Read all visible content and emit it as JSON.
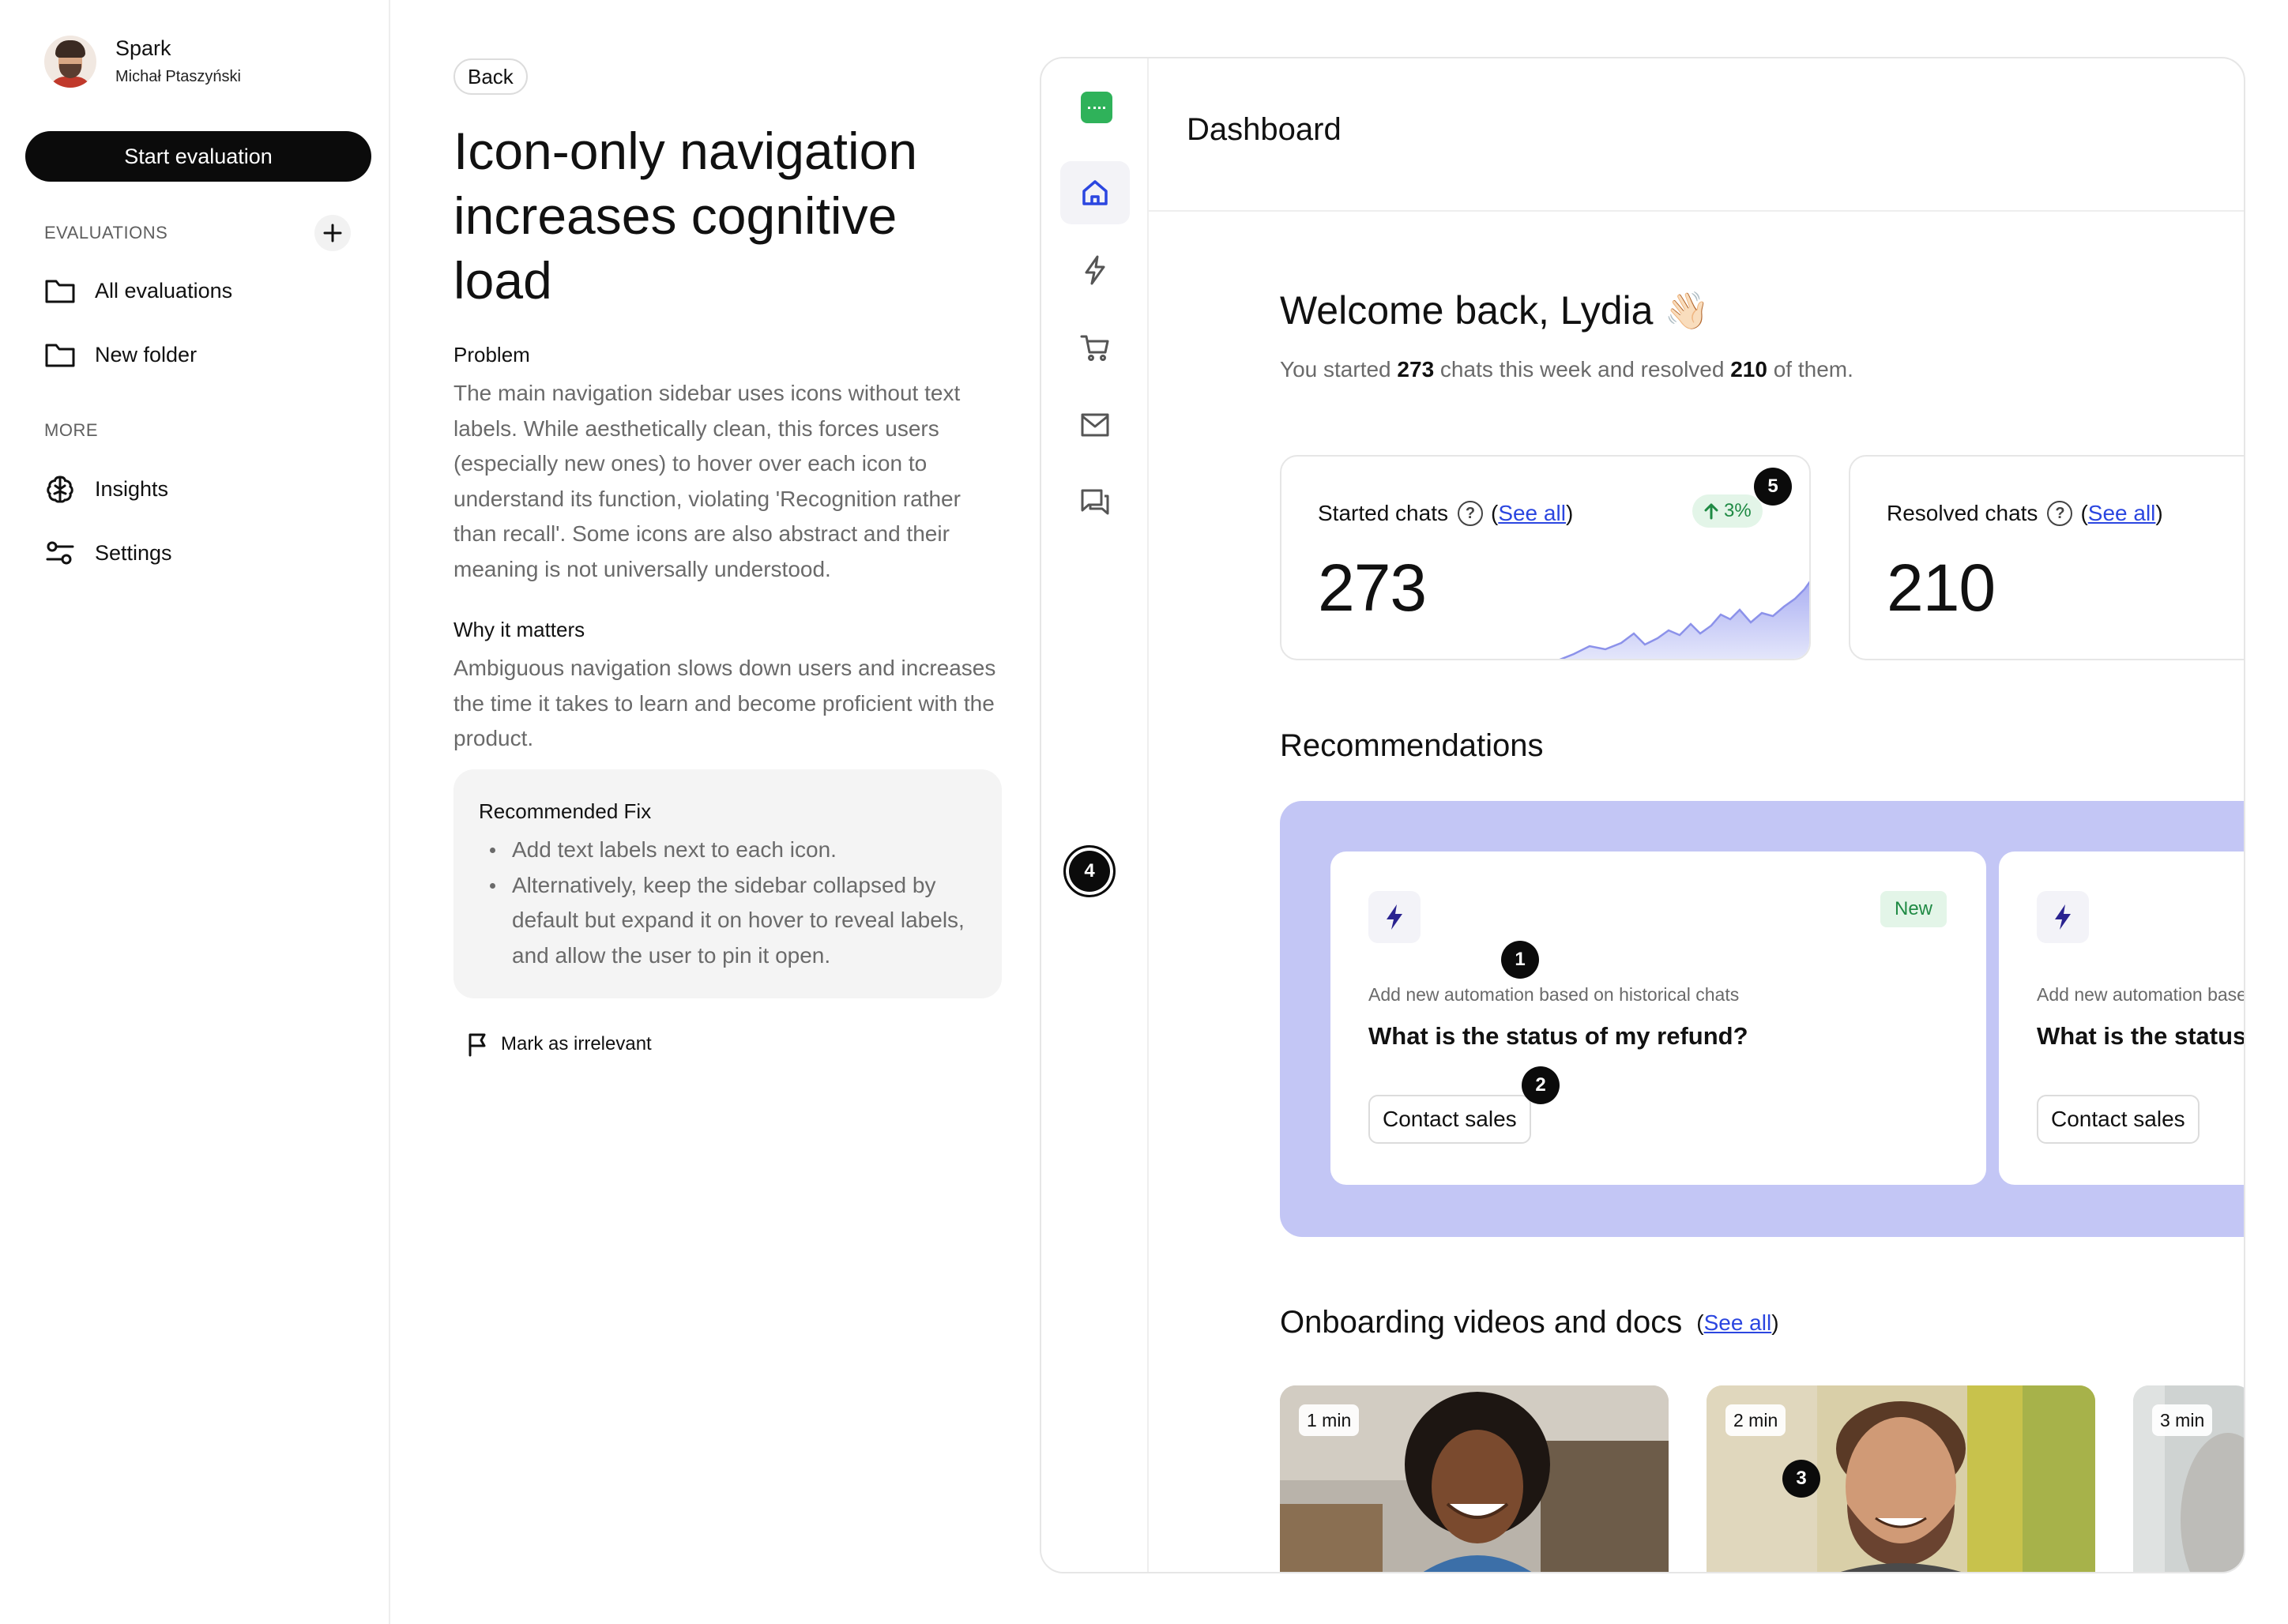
{
  "sidebar": {
    "profile": {
      "name": "Spark",
      "subtitle": "Michał Ptaszyński"
    },
    "start_button": "Start evaluation",
    "evaluations_label": "EVALUATIONS",
    "evaluations": [
      {
        "label": "All evaluations",
        "icon": "folder-icon"
      },
      {
        "label": "New folder",
        "icon": "folder-icon"
      }
    ],
    "more_label": "MORE",
    "more": [
      {
        "label": "Insights",
        "icon": "brain-icon"
      },
      {
        "label": "Settings",
        "icon": "sliders-icon"
      }
    ]
  },
  "issue": {
    "back": "Back",
    "title": "Icon-only navigation increases cognitive load",
    "problem_heading": "Problem",
    "problem_text": "The main navigation sidebar uses icons without text labels. While aesthetically clean, this forces users (especially new ones) to hover over each icon to understand its function, violating 'Recognition rather than recall'. Some icons are also abstract and their meaning is not universally understood.",
    "why_heading": "Why it matters",
    "why_text": "Ambiguous navigation slows down users and increases the time it takes to learn and become proficient with the product.",
    "fix_heading": "Recommended Fix",
    "fix_items": [
      "Add text labels next to each icon.",
      "Alternatively, keep the sidebar collapsed by default but expand it on hover to reveal labels, and allow the user to pin it open."
    ],
    "mark_irrelevant": "Mark as irrelevant"
  },
  "app": {
    "rail_icons": [
      "home-icon",
      "lightning-icon",
      "cart-icon",
      "mail-icon",
      "chat-icon"
    ],
    "page_title": "Dashboard",
    "welcome": "Welcome back, Lydia",
    "wave_emoji": "👋🏻",
    "summary": {
      "prefix": "You started ",
      "started": "273",
      "middle": " chats this week and resolved ",
      "resolved": "210",
      "suffix": " of them."
    },
    "stats": [
      {
        "label": "Started chats",
        "see_all": "See all",
        "value": "273",
        "trend": "3%"
      },
      {
        "label": "Resolved chats",
        "see_all": "See all",
        "value": "210"
      }
    ],
    "recommendations_title": "Recommendations",
    "recommendations": [
      {
        "badge": "New",
        "subtitle": "Add new automation based on historical chats",
        "question": "What is the status of my refund?",
        "button": "Contact sales"
      },
      {
        "subtitle": "Add new automation based on historical chats",
        "question": "What is the status of my refund?",
        "button": "Contact sales"
      }
    ],
    "onboarding_title": "Onboarding videos and docs",
    "onboarding_see_all": "See all",
    "videos": [
      {
        "duration": "1 min"
      },
      {
        "duration": "2 min"
      },
      {
        "duration": "3 min"
      }
    ]
  },
  "markers": [
    "1",
    "2",
    "3",
    "4",
    "5"
  ],
  "colors": {
    "accent_blue": "#2b46e0",
    "recommendation_bg": "#c3c6f5",
    "success_green": "#1f8a44",
    "logo_green": "#2fb25a"
  }
}
